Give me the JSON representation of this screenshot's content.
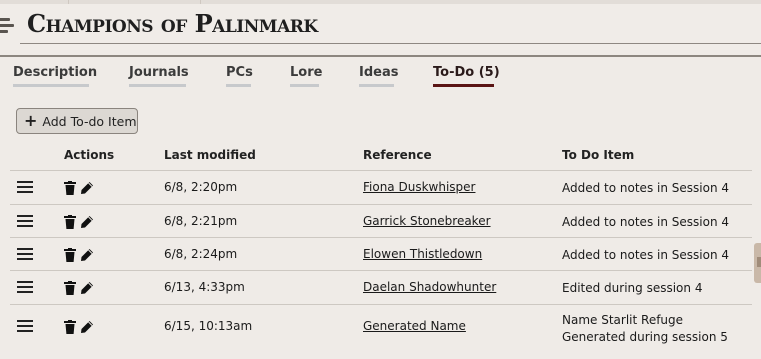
{
  "header": {
    "title": "Champions of Palinmark"
  },
  "tabs": [
    {
      "label": "Description"
    },
    {
      "label": "Journals"
    },
    {
      "label": "PCs"
    },
    {
      "label": "Lore"
    },
    {
      "label": "Ideas"
    },
    {
      "label": "To-Do (5)",
      "active": true
    }
  ],
  "toolbar": {
    "add_label": "Add To-do Item",
    "add_icon": "plus-icon"
  },
  "table": {
    "columns": [
      "Actions",
      "Last modified",
      "Reference",
      "To Do Item"
    ],
    "rows": [
      {
        "modified": "6/8, 2:20pm",
        "reference": "Fiona Duskwhisper",
        "todo": [
          "Added to notes in Session 4"
        ]
      },
      {
        "modified": "6/8, 2:21pm",
        "reference": "Garrick Stonebreaker",
        "todo": [
          "Added to notes in Session 4"
        ]
      },
      {
        "modified": "6/8, 2:24pm",
        "reference": "Elowen Thistledown",
        "todo": [
          "Added to notes in Session 4"
        ]
      },
      {
        "modified": "6/13, 4:33pm",
        "reference": "Daelan Shadowhunter",
        "todo": [
          "Edited during session 4"
        ]
      },
      {
        "modified": "6/15, 10:13am",
        "reference": "Generated Name",
        "todo": [
          "Name Starlit Refuge",
          "Generated during session 5"
        ]
      }
    ]
  },
  "colors": {
    "background": "#efebe7",
    "active_tab_underline": "#5a1414",
    "tab_underline": "#c7c9cc"
  }
}
